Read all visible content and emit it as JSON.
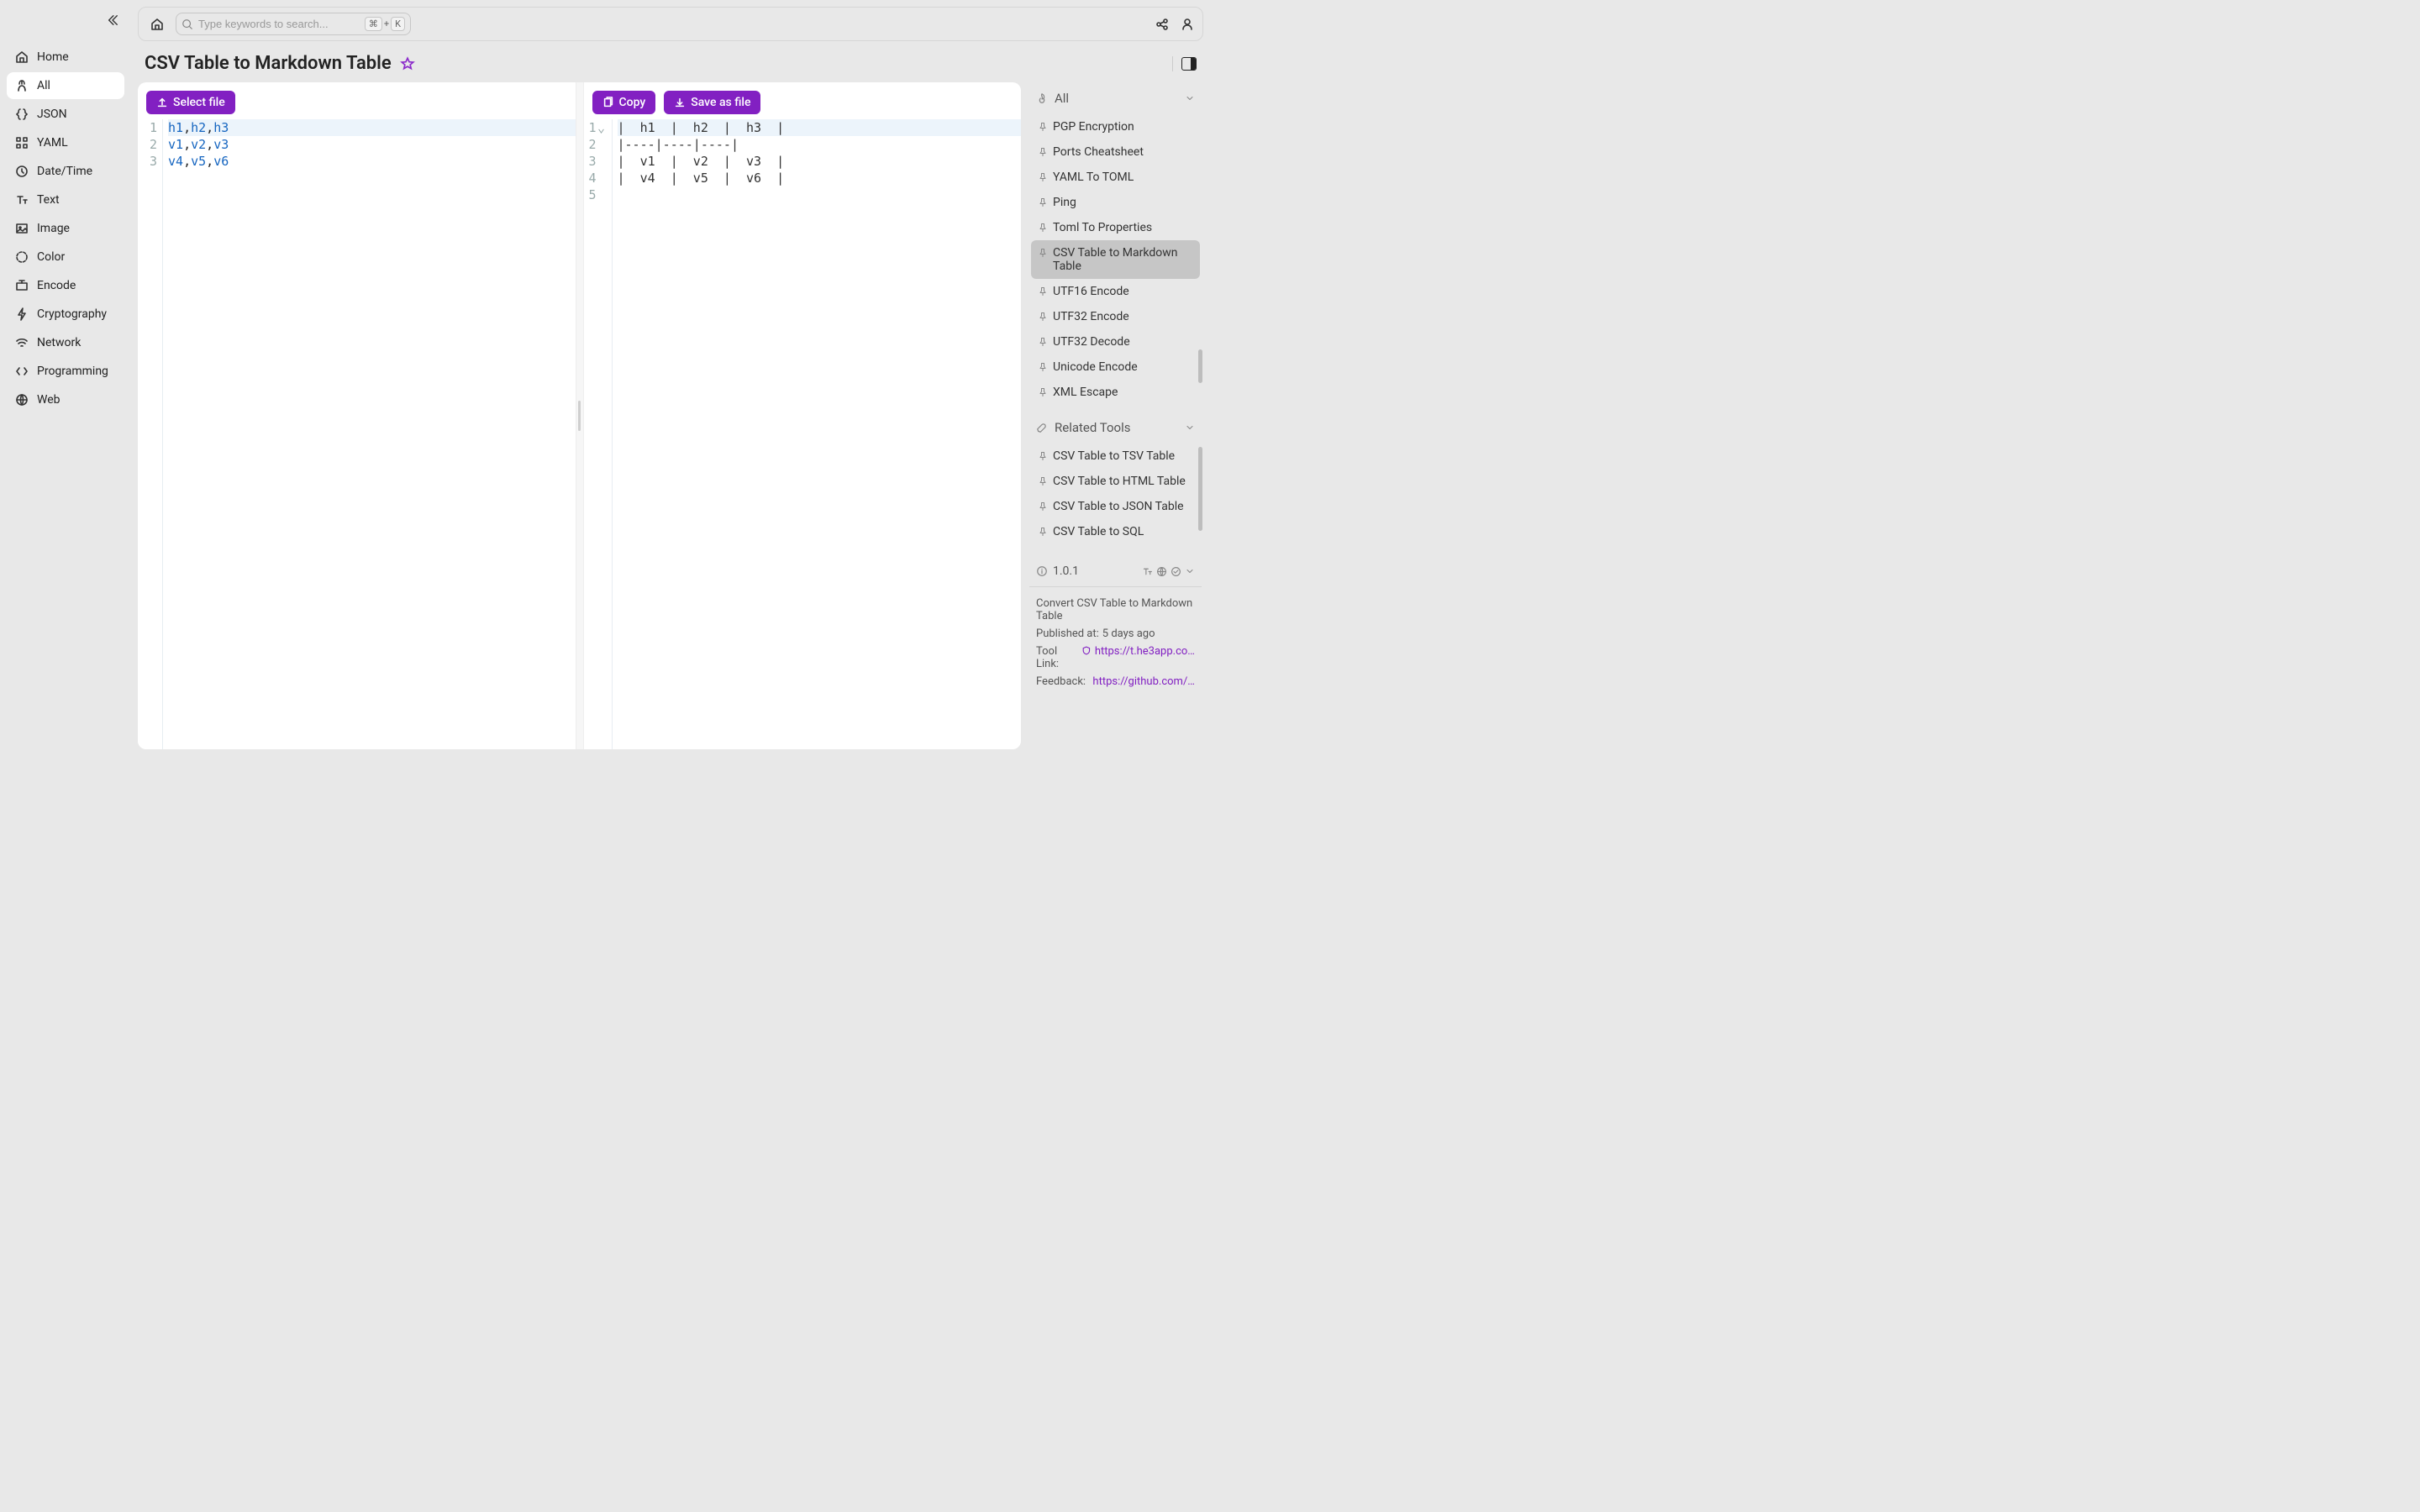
{
  "sidebar": {
    "items": [
      {
        "label": "Home"
      },
      {
        "label": "All"
      },
      {
        "label": "JSON"
      },
      {
        "label": "YAML"
      },
      {
        "label": "Date/Time"
      },
      {
        "label": "Text"
      },
      {
        "label": "Image"
      },
      {
        "label": "Color"
      },
      {
        "label": "Encode"
      },
      {
        "label": "Cryptography"
      },
      {
        "label": "Network"
      },
      {
        "label": "Programming"
      },
      {
        "label": "Web"
      }
    ]
  },
  "search": {
    "placeholder": "Type keywords to search...",
    "kbd_cmd": "⌘",
    "kbd_plus": "+",
    "kbd_k": "K"
  },
  "title": "CSV Table to Markdown Table",
  "editor": {
    "select_file": "Select file",
    "copy": "Copy",
    "save_as_file": "Save as file",
    "input_lines": [
      [
        "h1",
        ",",
        "h2",
        ",",
        "h3"
      ],
      [
        "v1",
        ",",
        "v2",
        ",",
        "v3"
      ],
      [
        "v4",
        ",",
        "v5",
        ",",
        "v6"
      ]
    ],
    "output_lines": [
      "|  h1  |  h2  |  h3  |",
      "|----|----|----|",
      "|  v1  |  v2  |  v3  |",
      "|  v4  |  v5  |  v6  |",
      ""
    ]
  },
  "all_panel": {
    "title": "All",
    "items": [
      "PGP Encryption",
      "Ports Cheatsheet",
      "YAML To TOML",
      "Ping",
      "Toml To Properties",
      "CSV Table to Markdown Table",
      "UTF16 Encode",
      "UTF32 Encode",
      "UTF32 Decode",
      "Unicode Encode",
      "XML Escape"
    ],
    "selected_index": 5
  },
  "related": {
    "title": "Related Tools",
    "items": [
      "CSV Table to TSV Table",
      "CSV Table to HTML Table",
      "CSV Table to JSON Table",
      "CSV Table to SQL"
    ]
  },
  "info": {
    "version": "1.0.1",
    "description": "Convert CSV Table to Markdown Table",
    "published_label": "Published at:",
    "published_value": "5 days ago",
    "toollink_label": "Tool Link:",
    "toollink_value": "https://t.he3app.co…",
    "feedback_label": "Feedback:",
    "feedback_value": "https://github.com/…"
  }
}
